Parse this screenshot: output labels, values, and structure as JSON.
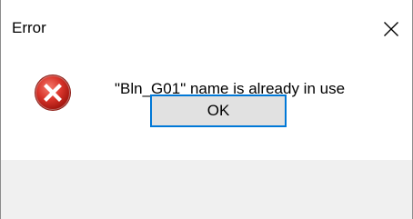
{
  "window": {
    "title": "Error",
    "close_icon": "close-icon"
  },
  "dialog": {
    "icon": "error-icon",
    "message": "\"Bln_G01\" name is already in use",
    "ok_label": "OK"
  },
  "colors": {
    "error_red": "#d9352b",
    "focus_blue": "#0078d7",
    "button_face": "#e1e1e1",
    "footer_bg": "#f0f0f0"
  }
}
